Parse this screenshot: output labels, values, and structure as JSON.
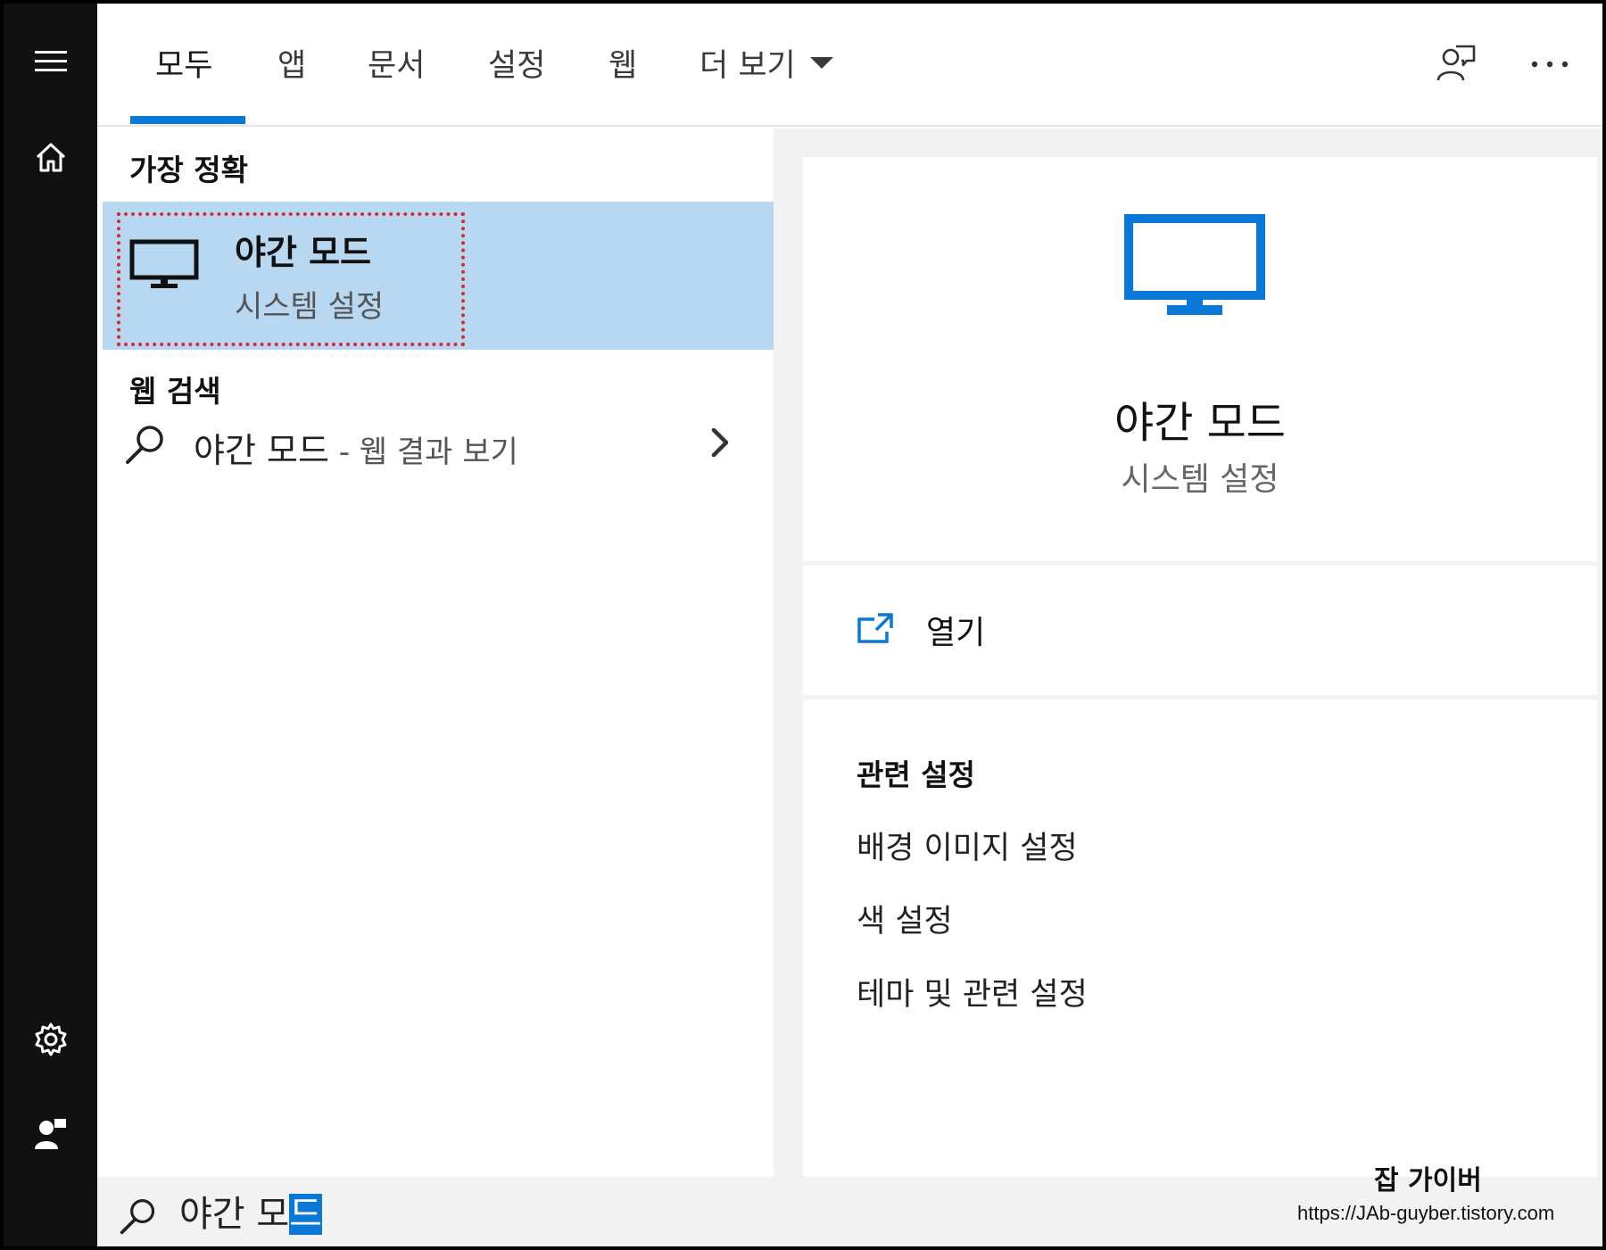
{
  "tabs": [
    {
      "label": "모두",
      "active": true
    },
    {
      "label": "앱"
    },
    {
      "label": "문서"
    },
    {
      "label": "설정"
    },
    {
      "label": "웹"
    },
    {
      "label": "더 보기"
    }
  ],
  "icons": {
    "menu": "hamburger-menu-icon",
    "home": "home-icon",
    "settings": "gear-icon",
    "account": "user-icon",
    "feedback": "feedback-icon",
    "more": "more-icon",
    "search": "search-icon",
    "app": "monitor-icon",
    "open": "open-external-icon",
    "chevron": "chevron-right-icon"
  },
  "results": {
    "best_match_header": "가장 정확",
    "best_match": {
      "title": "야간 모드",
      "subtitle": "시스템 설정"
    },
    "web_header": "웹 검색",
    "web_item": {
      "query": "야간 모드",
      "suffix": " - 웹 결과 보기"
    }
  },
  "preview": {
    "title": "야간 모드",
    "subtitle": "시스템 설정",
    "open_label": "열기",
    "related_header": "관련 설정",
    "related_links": [
      "배경 이미지 설정",
      "색 설정",
      "테마 및 관련 설정"
    ]
  },
  "search": {
    "typed": "야간 모",
    "selected": "드"
  },
  "watermark": {
    "title": "잡 가이버",
    "url": "https://JAb-guyber.tistory.com"
  },
  "colors": {
    "accent": "#0a78d7",
    "highlight": "#b8d8f2",
    "rail": "#111111",
    "marker": "#d22b36"
  }
}
